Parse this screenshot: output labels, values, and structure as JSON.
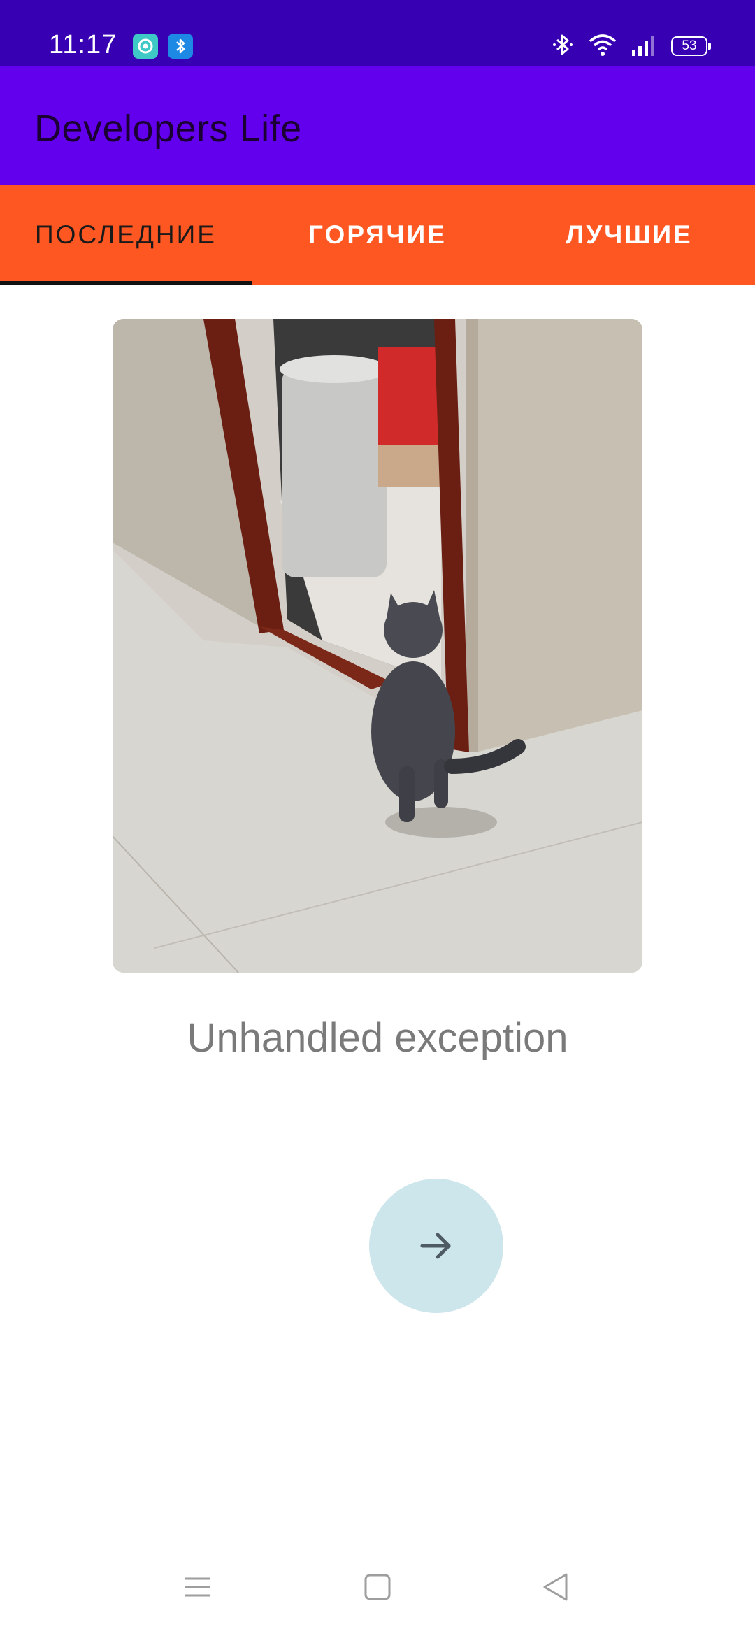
{
  "status_bar": {
    "time": "11:17",
    "battery": "53",
    "notification_icons": [
      "screen-recorder-icon",
      "bluetooth-notification-icon"
    ],
    "right_icons": [
      "bluetooth-icon",
      "wifi-icon",
      "signal-icon",
      "battery-icon"
    ]
  },
  "app_bar": {
    "title": "Developers Life",
    "color": "#6200ee"
  },
  "tabs": [
    {
      "label": "ПОСЛЕДНИЕ",
      "selected": true
    },
    {
      "label": "ГОРЯЧИЕ",
      "selected": false
    },
    {
      "label": "ЛУЧШИЕ",
      "selected": false
    }
  ],
  "tab_bar_color": "#ff5722",
  "post": {
    "image_icon": "cat-gif-image",
    "caption": "Unhandled exception"
  },
  "next_button": {
    "icon": "arrow-right-icon",
    "color": "#cde6ec"
  },
  "nav_bar": {
    "icons": [
      "menu-icon",
      "home-icon",
      "back-icon"
    ]
  }
}
